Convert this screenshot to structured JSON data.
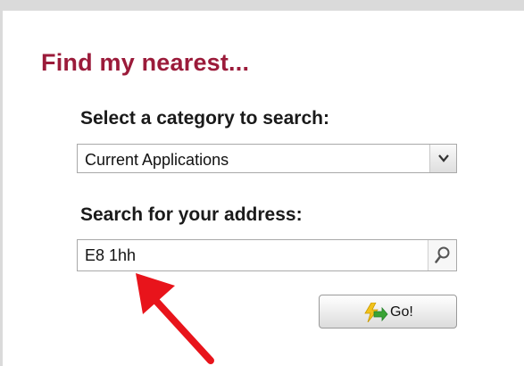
{
  "panel": {
    "title": "Find my nearest..."
  },
  "category": {
    "label": "Select a category to search:",
    "selected": "Current Applications"
  },
  "address": {
    "label": "Search for your address:",
    "value": "E8 1hh"
  },
  "go_button": {
    "label": "Go!"
  },
  "icons": {
    "dropdown": "chevron-down-icon",
    "search": "magnifier-icon",
    "go": "lightning-arrow-icon",
    "annotation": "red-arrow-icon"
  },
  "colors": {
    "title": "#9b1b3a",
    "annotation_arrow": "#e8141b",
    "go_icon_yellow": "#f2c21b",
    "go_icon_green": "#3aa335"
  }
}
